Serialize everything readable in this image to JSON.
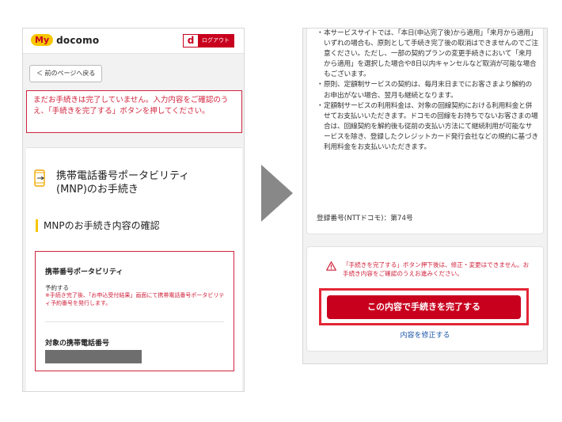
{
  "left": {
    "logo_my": "My",
    "logo_docomo": "docomo",
    "logout_d": "d",
    "logout_label": "ログアウト",
    "back_label": "＜ 前のページへ戻る",
    "warning_text": "まだお手続きは完了していません。入力内容をご確認のうえ、「手続きを完了する」ボタンを押してください。",
    "page_title": "携帯電話番号ポータビリティ(MNP)のお手続き",
    "section_heading": "MNPのお手続き内容の確認",
    "detail": {
      "label1": "携帯番号ポータビリティ",
      "value1": "予約する",
      "note1": "※手続き完了後、「お申込受付結果」画面にて携帯電話番号ポータビリティ予約番号を発行します。",
      "label2": "対象の携帯電話番号"
    }
  },
  "right": {
    "terms": [
      {
        "bullet": "・",
        "text": "本サービスサイトでは、「本日(申込完了後)から適用」「来月から適用」いずれの場合も、原則として手続き完了後の取消はできませんのでご注意ください。ただし、一部の契約プランの変更手続きにおいて「来月から適用」を選択した場合や8日以内キャンセルなど取消が可能な場合もございます。"
      },
      {
        "bullet": "・",
        "text": "原則、定額制サービスの契約は、毎月末日までにお客さまより解約のお申出がない場合、翌月も継続となります。"
      },
      {
        "bullet": "・",
        "text": "定額制サービスの利用料金は、対象の回線契約における利用料金と併せてお支払いいただきます。ドコモの回線をお持ちでないお客さまの場合は、回線契約を解約後も従前の支払い方法にて継続利用が可能なサービスを除き、登録したクレジットカード発行会社などの規約に基づき利用料金をお支払いいただきます。"
      }
    ],
    "registration": "登録番号(NTTドコモ)：第74号",
    "caution_text": "「手続きを完了する」ボタン押下後は、修正・変更はできません。お手続き内容をご確認のうえお進みください。",
    "complete_button": "この内容で手続きを完了する",
    "edit_link": "内容を修正する"
  },
  "colors": {
    "docomo_red": "#c8001e",
    "highlight_red": "#e32636",
    "accent_yellow": "#f7c600",
    "link_blue": "#1a55a6"
  }
}
